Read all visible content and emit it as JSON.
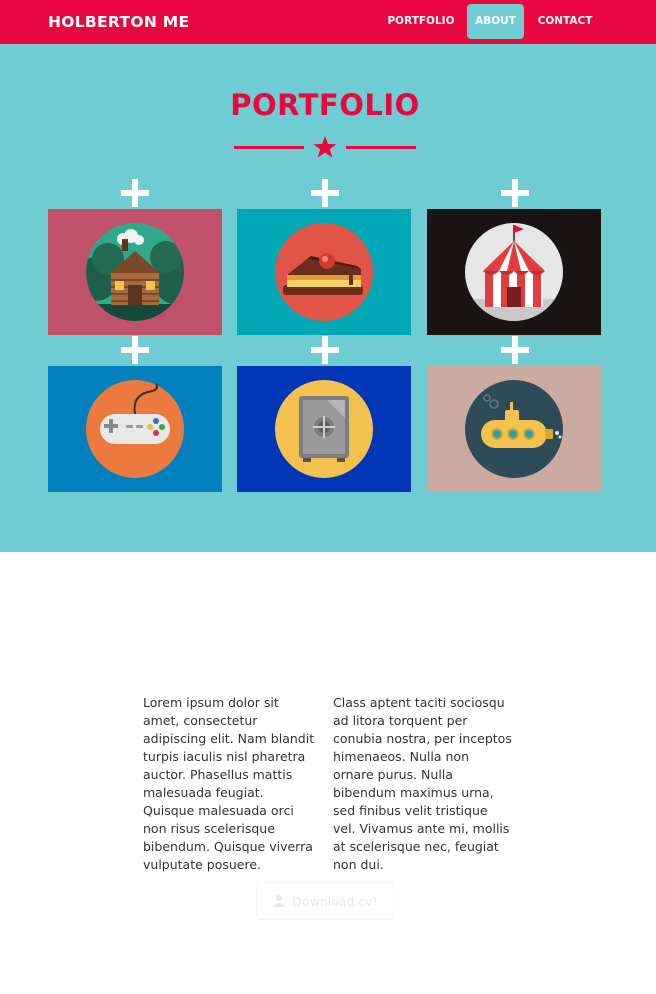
{
  "navbar": {
    "brand": "HOLBERTON ME",
    "items": [
      {
        "label": "PORTFOLIO",
        "active": false
      },
      {
        "label": "ABOUT",
        "active": true
      },
      {
        "label": "CONTACT",
        "active": false
      }
    ]
  },
  "portfolio": {
    "title": "PORTFOLIO",
    "tiles": [
      {
        "icon": "cabin-icon",
        "background": "#c0536a"
      },
      {
        "icon": "cake-icon",
        "background": "#00a7b5"
      },
      {
        "icon": "circus-tent-icon",
        "background": "#1a1414"
      },
      {
        "icon": "game-controller-icon",
        "background": "#0080bc"
      },
      {
        "icon": "safe-icon",
        "background": "#0037b8"
      },
      {
        "icon": "submarine-icon",
        "background": "#cbaaa0"
      }
    ]
  },
  "about": {
    "column_left": "Lorem ipsum dolor sit amet, consectetur adipiscing elit. Nam blandit turpis iaculis nisl pharetra auctor. Phasellus mattis malesuada feugiat. Quisque malesuada orci non risus scelerisque bibendum. Quisque viverra vulputate posuere.",
    "column_right": "Class aptent taciti sociosqu ad litora torquent per conubia nostra, per inceptos himenaeos. Nulla non ornare purus. Nulla bibendum maximus urna, sed finibus velit tristique vel. Vivamus ante mi, mollis at scelerisque nec, feugiat non dui.",
    "download_label": "Download cv!"
  },
  "colors": {
    "accent": "#e8073f",
    "teal": "#6fccd3"
  }
}
